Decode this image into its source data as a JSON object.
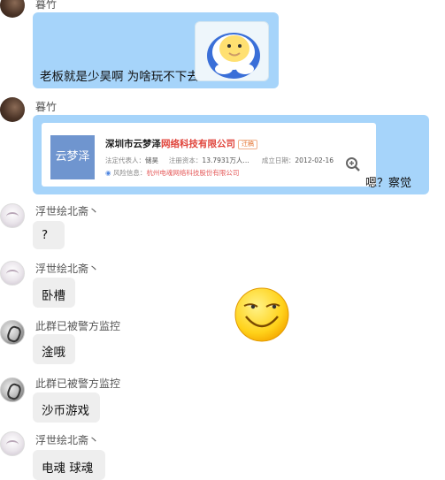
{
  "messages": [
    {
      "sender": "暮竹",
      "text": "老板就是少昊啊 为啥玩不下去"
    },
    {
      "sender": "暮竹",
      "suffix_text": "嗯？察觉"
    },
    {
      "sender": "浮世绘北斋丶",
      "text": "?"
    },
    {
      "sender": "浮世绘北斋丶",
      "text": "卧槽"
    },
    {
      "sender": "此群已被警方监控",
      "text": "淦哦"
    },
    {
      "sender": "此群已被警方监控",
      "text": "沙币游戏"
    },
    {
      "sender": "浮世绘北斋丶",
      "text": "电魂 球魂"
    }
  ],
  "company_card": {
    "logo_text": "云梦泽",
    "name_prefix": "深圳市云梦泽",
    "name_highlight": "网络科技有限公司",
    "status_tag": "迁稿",
    "legal_rep_label": "法定代表人：",
    "legal_rep_value": "储昊",
    "capital_label": "注册资本：",
    "capital_value": "13.7931万人...",
    "founded_label": "成立日期：",
    "founded_value": "2012-02-16",
    "risk_label": "风险信息：",
    "risk_value": "杭州电魂网络科技股份有限公司"
  },
  "icons": {
    "sticker": "penguin-sticker-icon",
    "zoom": "zoom-in-icon",
    "emoji": "grin-emoji-icon"
  },
  "colors": {
    "bubble_blue": "#a6d4fa",
    "bubble_gray": "#eeeeee",
    "highlight_red": "#e0443b"
  }
}
